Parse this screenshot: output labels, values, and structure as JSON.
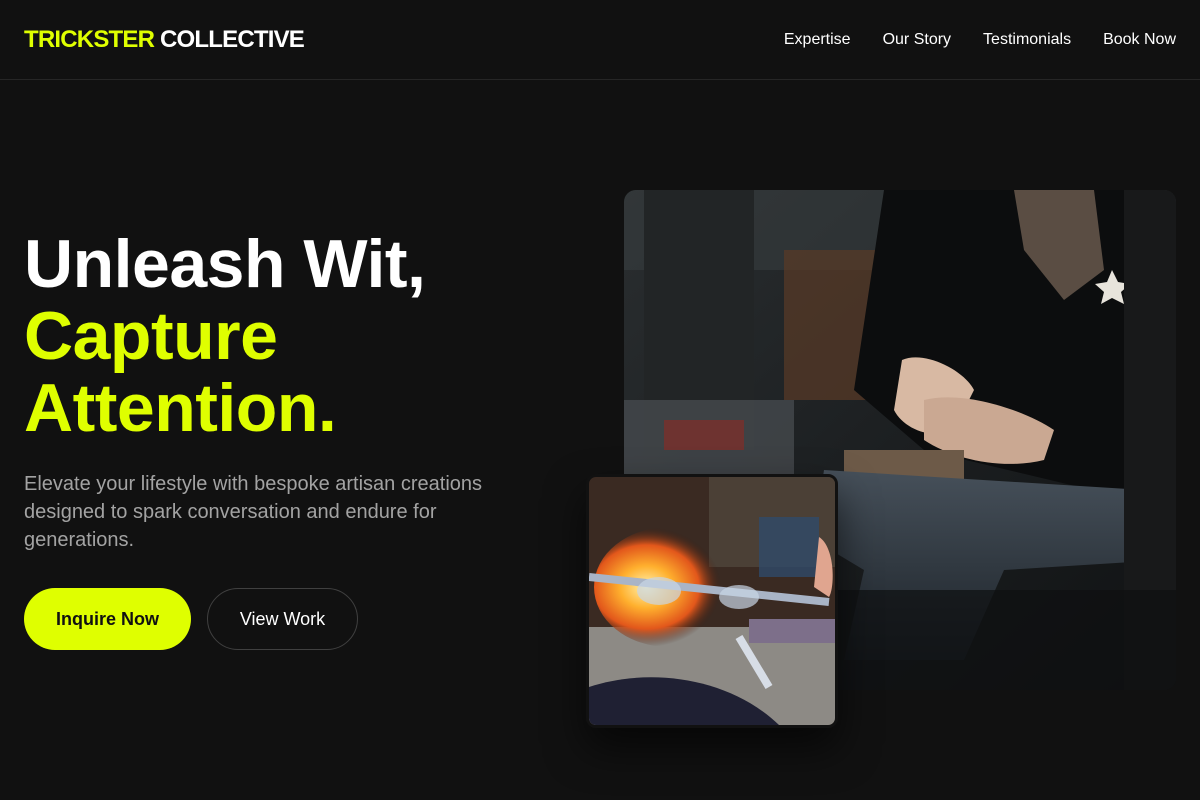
{
  "brand": {
    "accent": "TRICKSTER",
    "rest": "COLLECTIVE"
  },
  "nav": [
    {
      "label": "Expertise"
    },
    {
      "label": "Our Story"
    },
    {
      "label": "Testimonials"
    },
    {
      "label": "Book Now"
    }
  ],
  "hero": {
    "headline_line1": "Unleash Wit,",
    "headline_line2": "Capture",
    "headline_line3": "Attention.",
    "subtitle": "Elevate your lifestyle with bespoke artisan creations designed to spark conversation and endure for generations.",
    "primary_cta": "Inquire Now",
    "secondary_cta": "View Work"
  },
  "images": {
    "main": "jewelry-artisan-at-anvil-photo",
    "secondary": "glassblowing-torch-photo"
  },
  "colors": {
    "background": "#111111",
    "accent": "#dfff00",
    "text": "#ffffff",
    "muted": "#a3a3a3"
  }
}
